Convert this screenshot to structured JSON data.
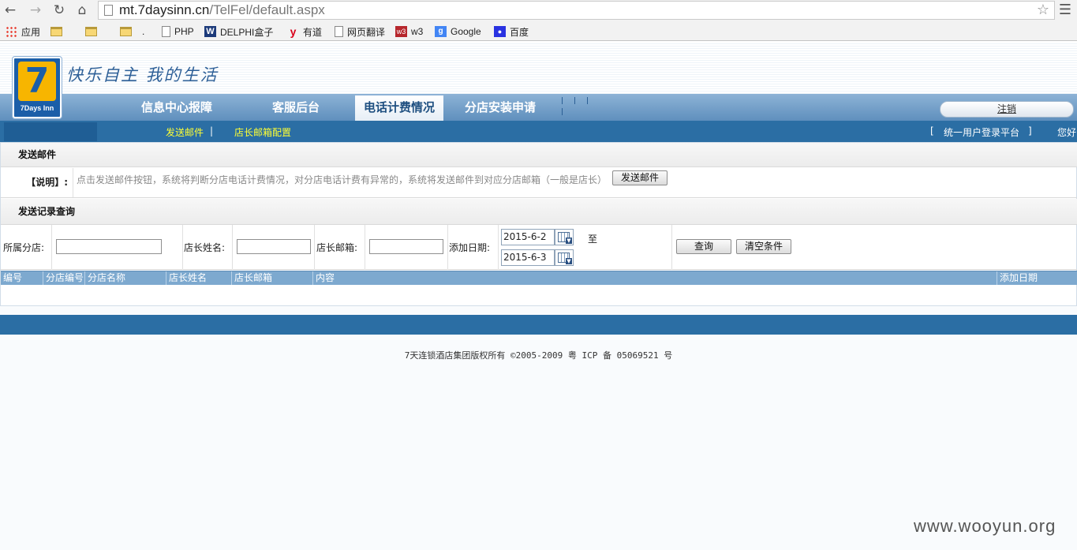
{
  "browser": {
    "url_host": "mt.7daysinn.cn",
    "url_path": "/TelFel/default.aspx",
    "bookmarks": [
      "应用",
      "",
      "",
      ".",
      "PHP",
      "DELPHI盒子",
      "有道",
      "网页翻译",
      "w3",
      "Google",
      "百度"
    ]
  },
  "header": {
    "logo_number": "7",
    "logo_text": "7Days Inn",
    "slogan": "快乐自主 我的生活",
    "tabs": [
      "信息中心报障",
      "客服后台",
      "电话计费情况",
      "分店安装申请"
    ],
    "active_tab": "电话计费情况",
    "logout_label": "注销"
  },
  "subnav": {
    "send_mail": "发送邮件",
    "sep": "|",
    "mailbox_config": "店长邮箱配置",
    "bracket_left": "[",
    "platform": "统一用户登录平台",
    "bracket_right": "]",
    "greeting": "您好"
  },
  "send_section": {
    "title": "发送邮件",
    "desc_label": "【说明】:",
    "desc_text": "点击发送邮件按钮，系统将判断分店电话计费情况，对分店电话计费有异常的，系统将发送邮件到对应分店邮箱（一般是店长）",
    "send_button": "发送邮件"
  },
  "query_section": {
    "title": "发送记录查询",
    "branch_label": "所属分店:",
    "branch_value": "",
    "manager_label": "店长姓名:",
    "manager_value": "",
    "email_label": "店长邮箱:",
    "email_value": "",
    "date_label": "添加日期:",
    "date_from": "2015-6-2",
    "to_label": "至",
    "date_to": "2015-6-3",
    "query_button": "查询",
    "clear_button": "清空条件"
  },
  "grid": {
    "columns": [
      "编号",
      "分店编号",
      "分店名称",
      "店长姓名",
      "店长邮箱",
      "内容",
      "添加日期"
    ]
  },
  "footer": {
    "copyright": "7天连锁酒店集团版权所有 ©2005-2009 粤 ICP 备 05069521 号"
  },
  "watermark": "www.wooyun.org",
  "colors": {
    "nav_blue": "#2b6ea4",
    "subnav_link": "#ffff33",
    "grid_header": "#7da9cf"
  }
}
